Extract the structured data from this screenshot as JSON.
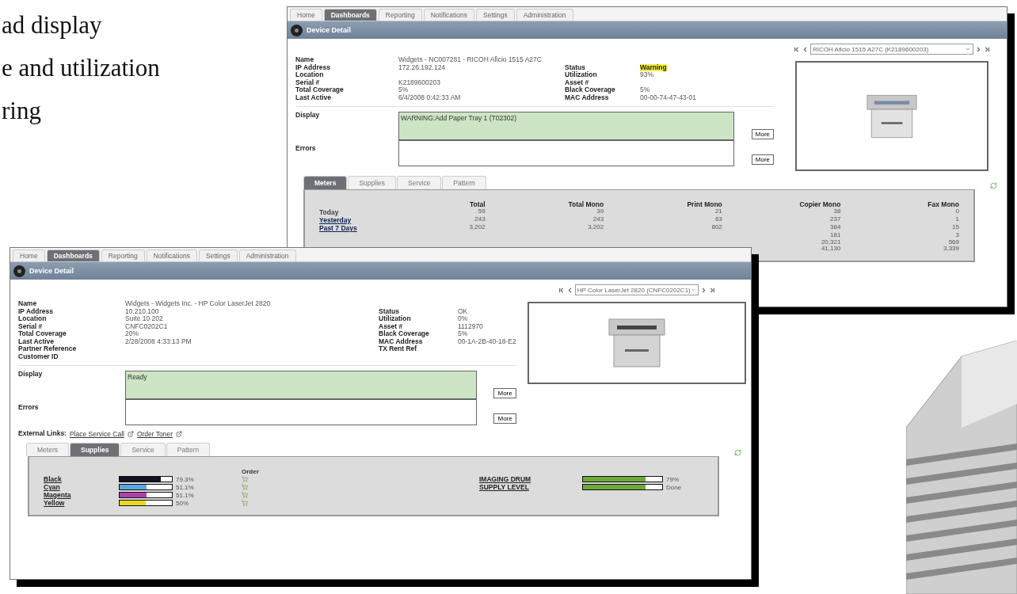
{
  "slide": {
    "bullets": [
      "ad display",
      "e and utilization",
      "ring"
    ]
  },
  "windows": [
    {
      "nav_tabs": [
        {
          "label": "Home",
          "selected": false
        },
        {
          "label": "Dashboards",
          "selected": true
        },
        {
          "label": "Reporting",
          "selected": false
        },
        {
          "label": "Notifications",
          "selected": false
        },
        {
          "label": "Settings",
          "selected": false
        },
        {
          "label": "Administration",
          "selected": false
        }
      ],
      "title": "Device Detail",
      "device_select": "RICOH Aficio 1515 A27C (K2189600203)",
      "info_rows": [
        {
          "left": {
            "label": "Name",
            "value": "Widgets - NC007281 - RICOH Aficio 1515 A27C"
          }
        },
        {
          "left": {
            "label": "IP Address",
            "value": "172.26.192.124"
          },
          "right": {
            "label": "Status",
            "value": "Warning",
            "highlighted": true
          }
        },
        {
          "left": {
            "label": "Location"
          },
          "right": {
            "label": "Utilization",
            "value": "93%",
            "highlighted": false
          }
        },
        {
          "left": {
            "label": "Serial #",
            "value": "K2189600203"
          },
          "right": {
            "label": "Asset #"
          }
        },
        {
          "left": {
            "label": "Total Coverage",
            "value": "5%"
          },
          "right": {
            "label": "Black Coverage",
            "value": "5%",
            "highlighted": false
          }
        },
        {
          "left": {
            "label": "Last Active",
            "value": "6/4/2008 0:42:33 AM"
          },
          "right": {
            "label": "MAC Address",
            "value": "00-00-74-47-43-01",
            "highlighted": false
          }
        }
      ],
      "display": {
        "label": "Display",
        "value": "WARNING:Add Paper Tray 1 (T02302)",
        "button": "More"
      },
      "errors": {
        "label": "Errors",
        "button": "More"
      },
      "detail_tabs": [
        {
          "label": "Meters",
          "selected": true
        },
        {
          "label": "Supplies",
          "selected": false
        },
        {
          "label": "Service",
          "selected": false
        },
        {
          "label": "Pattern",
          "selected": false
        }
      ],
      "panel": {
        "kind": "meters",
        "columns": [
          "Total",
          "Total Mono",
          "Print Mono",
          "Copier Mono",
          "Fax Mono"
        ],
        "rows": [
          {
            "label": "Today",
            "link": false,
            "values": [
              "59",
              "39",
              "21",
              "38",
              "0"
            ]
          },
          {
            "label": "Yesterday",
            "link": true,
            "values": [
              "243",
              "243",
              "63",
              "237",
              "1"
            ]
          },
          {
            "label": "Past 7 Days",
            "link": true,
            "values": [
              "3,202",
              "3,202",
              "802",
              "384",
              "15"
            ]
          },
          {
            "values": [
              "181",
              "3"
            ]
          },
          {
            "values": [
              "20,321",
              "569"
            ]
          },
          {
            "values": [
              "41,130",
              "3,339"
            ]
          }
        ]
      }
    },
    {
      "nav_tabs": [
        {
          "label": "Home",
          "selected": false
        },
        {
          "label": "Dashboards",
          "selected": true
        },
        {
          "label": "Reporting",
          "selected": false
        },
        {
          "label": "Notifications",
          "selected": false
        },
        {
          "label": "Settings",
          "selected": false
        },
        {
          "label": "Administration",
          "selected": false
        }
      ],
      "title": "Device Detail",
      "device_select": "HP Color LaserJet 2820 (CNFC0202C1)",
      "info_rows": [
        {
          "left": {
            "label": "Name",
            "value": "Widgets - Widgets Inc. - HP Color LaserJet 2820"
          }
        },
        {
          "left": {
            "label": "IP Address",
            "value": "10.210.100"
          },
          "right": {
            "label": "Status",
            "value": "OK",
            "highlighted": false
          }
        },
        {
          "left": {
            "label": "Location",
            "value": "Suite 10 202"
          },
          "right": {
            "label": "Utilization",
            "value": "0%",
            "highlighted": false
          }
        },
        {
          "left": {
            "label": "Serial #",
            "value": "CNFC0202C1"
          },
          "right": {
            "label": "Asset #",
            "value": "1112970",
            "highlighted": false
          }
        },
        {
          "left": {
            "label": "Total Coverage",
            "value": "20%"
          },
          "right": {
            "label": "Black Coverage",
            "value": "5%",
            "highlighted": false
          }
        },
        {
          "left": {
            "label": "Last Active",
            "value": "2/28/2008 4:33:13 PM"
          },
          "right": {
            "label": "MAC Address",
            "value": "00-1A-2B-40-18-E2",
            "highlighted": false
          }
        },
        {
          "left": {
            "label": "Partner Reference"
          },
          "right": {
            "label": "TX Rent Ref"
          }
        },
        {
          "left": {
            "label": "Customer ID"
          }
        }
      ],
      "display": {
        "label": "Display",
        "value": "Ready",
        "button": "More"
      },
      "errors": {
        "label": "Errors",
        "button": "More"
      },
      "external_links": {
        "label": "External Links:",
        "links": [
          "Place Service Call",
          "Order Toner"
        ]
      },
      "detail_tabs": [
        {
          "label": "Meters",
          "selected": false
        },
        {
          "label": "Supplies",
          "selected": true
        },
        {
          "label": "Service",
          "selected": false
        },
        {
          "label": "Pattern",
          "selected": false
        }
      ],
      "panel": {
        "kind": "supplies",
        "order_heading": "Order",
        "supplies": [
          {
            "name": "Black",
            "color": "#111122",
            "level": 0.79,
            "reading": "79.3%"
          },
          {
            "name": "Cyan",
            "color": "#5aa6e0",
            "level": 0.51,
            "reading": "51.1%"
          },
          {
            "name": "Magenta",
            "color": "#b040a8",
            "level": 0.51,
            "reading": "51.1%"
          },
          {
            "name": "Yellow",
            "color": "#e8d820",
            "level": 0.5,
            "reading": "50%"
          }
        ],
        "other": [
          {
            "name": "IMAGING DRUM",
            "level": 0.79,
            "reading": "79%"
          },
          {
            "name": "SUPPLY LEVEL",
            "level": 0.79,
            "reading": "Done"
          }
        ]
      }
    }
  ]
}
